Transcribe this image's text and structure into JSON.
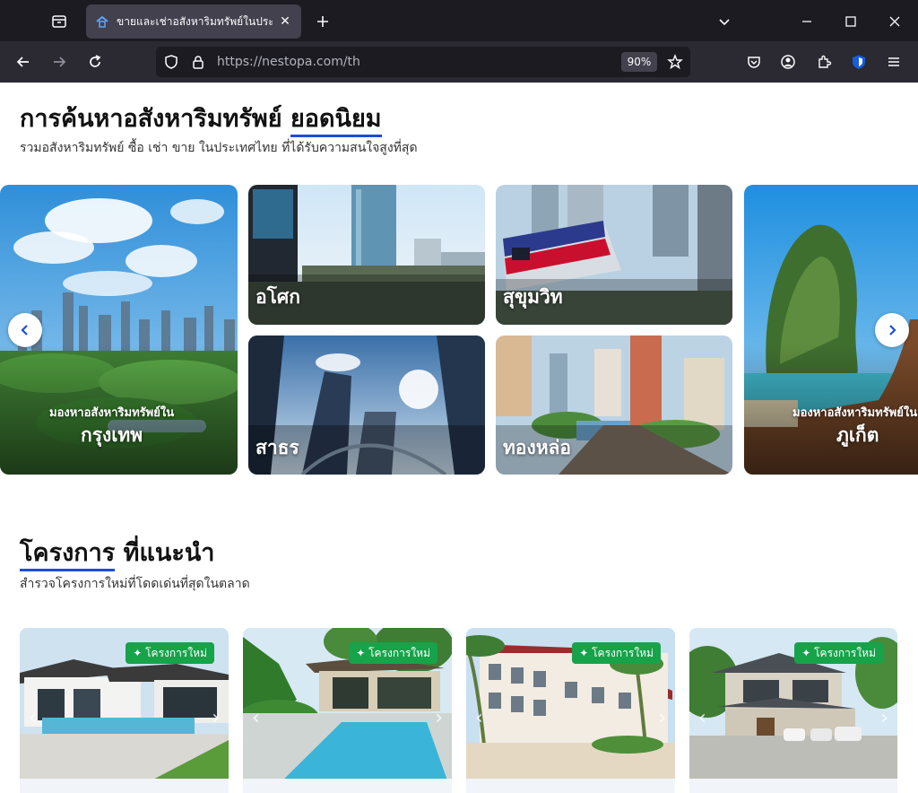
{
  "browser": {
    "tab_title": "ขายและเช่าอสังหาริมทรัพย์ในประเทศไทย",
    "url": "https://nestopa.com/th",
    "zoom": "90%"
  },
  "popular": {
    "title_main": "การค้นหาอสังหาริมทรัพย์",
    "title_accent": "ยอดนิยม",
    "subtitle": "รวมอสังหาริมทรัพย์ ซื้อ เช่า ขาย ในประเทศไทย ที่ได้รับความสนใจสูงที่สุด",
    "cards": [
      {
        "small": "มองหาอสังหาริมทรัพย์ใน",
        "big": "กรุงเทพ"
      },
      {
        "small": "",
        "big": "อโศก"
      },
      {
        "small": "",
        "big": "สุขุมวิท"
      },
      {
        "small": "",
        "big": "สาธร"
      },
      {
        "small": "",
        "big": "ทองหล่อ"
      },
      {
        "small": "มองหาอสังหาริมทรัพย์ใน",
        "big": "ภูเก็ต"
      }
    ]
  },
  "projects": {
    "title_accent": "โครงการ",
    "title_rest": "ที่แนะนำ",
    "subtitle": "สำรวจโครงการใหม่ที่โดดเด่นที่สุดในตลาด",
    "badge": "โครงการใหม่",
    "items": [
      "villa-1",
      "pool-house",
      "resort-building",
      "townhouse"
    ]
  },
  "colors": {
    "accent": "#1d4ed8",
    "badge": "#16a34a"
  }
}
